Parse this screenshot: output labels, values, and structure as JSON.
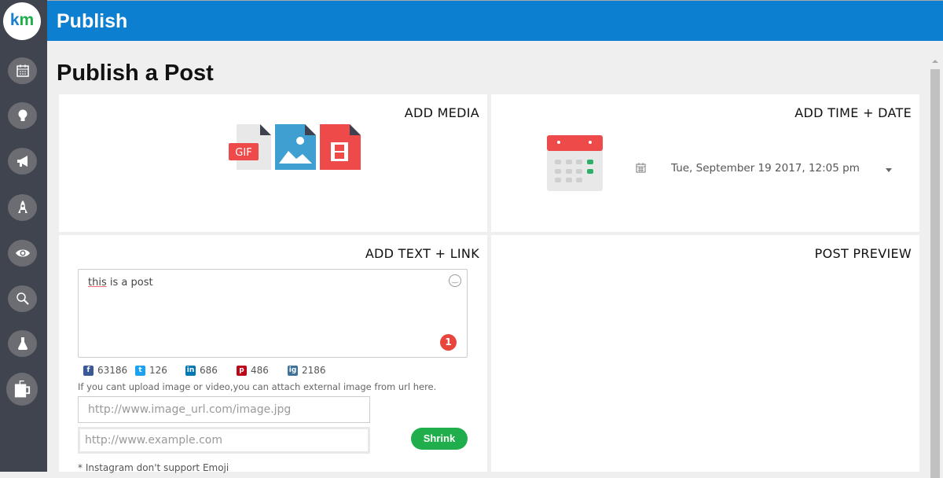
{
  "app": {
    "logo_k": "k",
    "logo_m": "m",
    "header_title": "Publish"
  },
  "sidebar": {
    "items": [
      {
        "icon": "calendar-icon"
      },
      {
        "icon": "lightbulb-icon"
      },
      {
        "icon": "megaphone-icon"
      },
      {
        "icon": "rocket-icon"
      },
      {
        "icon": "eye-icon"
      },
      {
        "icon": "search-icon"
      },
      {
        "icon": "flask-icon"
      },
      {
        "icon": "mug-icon"
      }
    ]
  },
  "page": {
    "title": "Publish a Post"
  },
  "media": {
    "title": "ADD MEDIA",
    "gif_label": "GIF"
  },
  "time": {
    "title": "ADD TIME + DATE",
    "datetime": "Tue, September 19 2017, 12:05 pm"
  },
  "text": {
    "title": "ADD TEXT + LINK",
    "post_word1": "this",
    "post_rest": " is a post",
    "char_count": "1",
    "social": [
      {
        "name": "facebook",
        "glyph": "f",
        "count": "63186",
        "color": "#3b5998"
      },
      {
        "name": "twitter",
        "glyph": "t",
        "count": "126",
        "color": "#1da1f2"
      },
      {
        "name": "linkedin",
        "glyph": "in",
        "count": "686",
        "color": "#0077b5"
      },
      {
        "name": "pinterest",
        "glyph": "p",
        "count": "486",
        "color": "#bd081c"
      },
      {
        "name": "instagram",
        "glyph": "ig",
        "count": "2186",
        "color": "#3f729b"
      }
    ],
    "hint": "If you cant upload image or video,you can attach external image from url here.",
    "image_url_placeholder": "http://www.image_url.com/image.jpg",
    "link_placeholder": "http://www.example.com",
    "shrink_label": "Shrink",
    "note": "* Instagram don't support Emoji"
  },
  "preview": {
    "title": "POST PREVIEW"
  }
}
